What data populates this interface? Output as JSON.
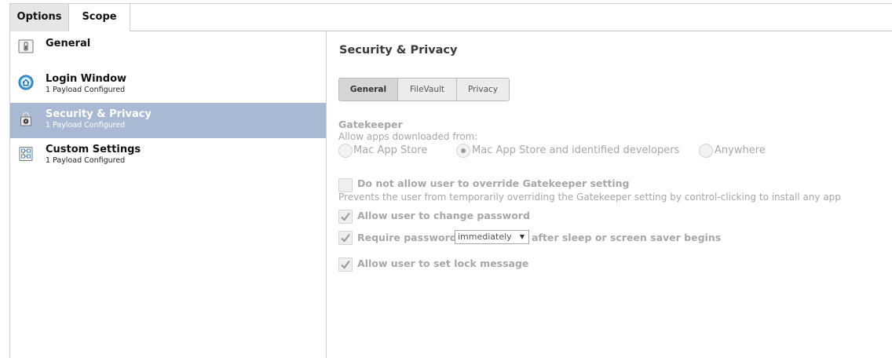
{
  "top_tabs": [
    {
      "label": "Options",
      "active": true
    },
    {
      "label": "Scope",
      "active": false
    }
  ],
  "sidebar": {
    "items": [
      {
        "title": "General",
        "subtitle": "",
        "icon": "switch-icon",
        "selected": false
      },
      {
        "title": "Login Window",
        "subtitle": "1 Payload Configured",
        "icon": "home-icon",
        "selected": true
      },
      {
        "title": "Security & Privacy",
        "subtitle": "1 Payload Configured",
        "icon": "lock-icon",
        "selected": true
      },
      {
        "title": "Custom Settings",
        "subtitle": "1 Payload Configured",
        "icon": "settings-file-icon",
        "selected": false
      }
    ]
  },
  "content": {
    "title": "Security & Privacy",
    "subtabs": [
      {
        "label": "General",
        "active": true
      },
      {
        "label": "FileVault",
        "active": false
      },
      {
        "label": "Privacy",
        "active": false
      }
    ],
    "gatekeeper": {
      "heading": "Gatekeeper",
      "subheading": "Allow apps downloaded from:",
      "options": [
        {
          "label": "Mac App Store",
          "checked": false
        },
        {
          "label": "Mac App Store and identified developers",
          "checked": true
        },
        {
          "label": "Anywhere",
          "checked": false
        }
      ]
    },
    "override_checkbox": {
      "label": "Do not allow user to override Gatekeeper setting",
      "checked": false,
      "description": "Prevents the user from temporarily overriding the Gatekeeper setting by control-clicking to install any app"
    },
    "change_password": {
      "label": "Allow user to change password",
      "checked": true
    },
    "require_password": {
      "label_before": "Require password",
      "select_value": "immediately",
      "label_after": "after sleep or screen saver begins",
      "checked": true
    },
    "lock_message": {
      "label": "Allow user to set lock message",
      "checked": true
    }
  },
  "colors": {
    "selected_row": "#a9b9d3",
    "disabled_text": "#a7a7a7",
    "tab_active": "#e6e6e6"
  }
}
